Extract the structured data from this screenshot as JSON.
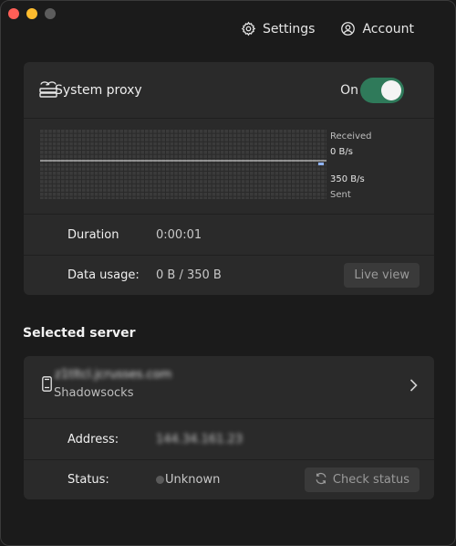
{
  "window": {
    "traffic_lights": [
      "close",
      "minimize",
      "maximize"
    ]
  },
  "nav": {
    "settings_label": "Settings",
    "account_label": "Account"
  },
  "proxy": {
    "title": "System proxy",
    "toggle_label": "On",
    "toggle_on": true,
    "accent_color": "#2f7a5a"
  },
  "graph": {
    "received_label": "Received",
    "received_value": "0 B/s",
    "sent_value": "350 B/s",
    "sent_label": "Sent"
  },
  "stats": {
    "duration_label": "Duration",
    "duration_value": "0:00:01",
    "usage_label": "Data usage:",
    "usage_value": "0 B / 350 B",
    "live_view_label": "Live view"
  },
  "server_section": {
    "title": "Selected server"
  },
  "server": {
    "name": "z1tltcl.jcrusses.com",
    "protocol": "Shadowsocks",
    "address_label": "Address:",
    "address_value": "144.34.161.23",
    "status_label": "Status:",
    "status_value": "Unknown",
    "check_status_label": "Check status"
  }
}
